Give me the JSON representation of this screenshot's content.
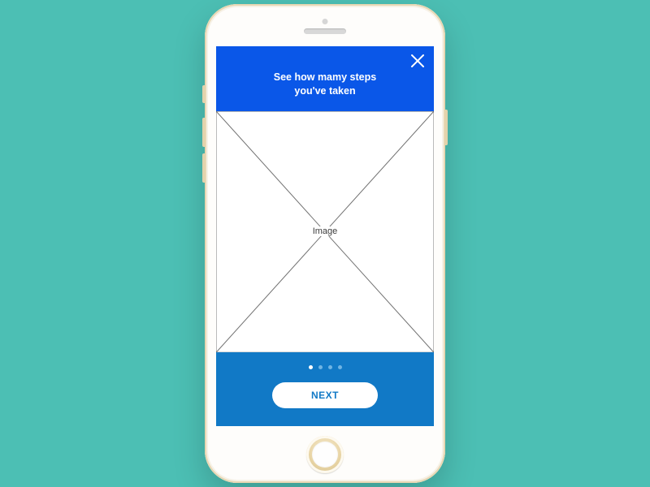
{
  "header": {
    "title_line1": "See how mamy steps",
    "title_line2": "you've taken"
  },
  "image_placeholder": {
    "label": "Image"
  },
  "pager": {
    "total": 4,
    "active_index": 0
  },
  "footer": {
    "next_label": "NEXT"
  },
  "colors": {
    "background": "#4cbfb4",
    "header": "#0a57e8",
    "footer": "#1179c6"
  }
}
